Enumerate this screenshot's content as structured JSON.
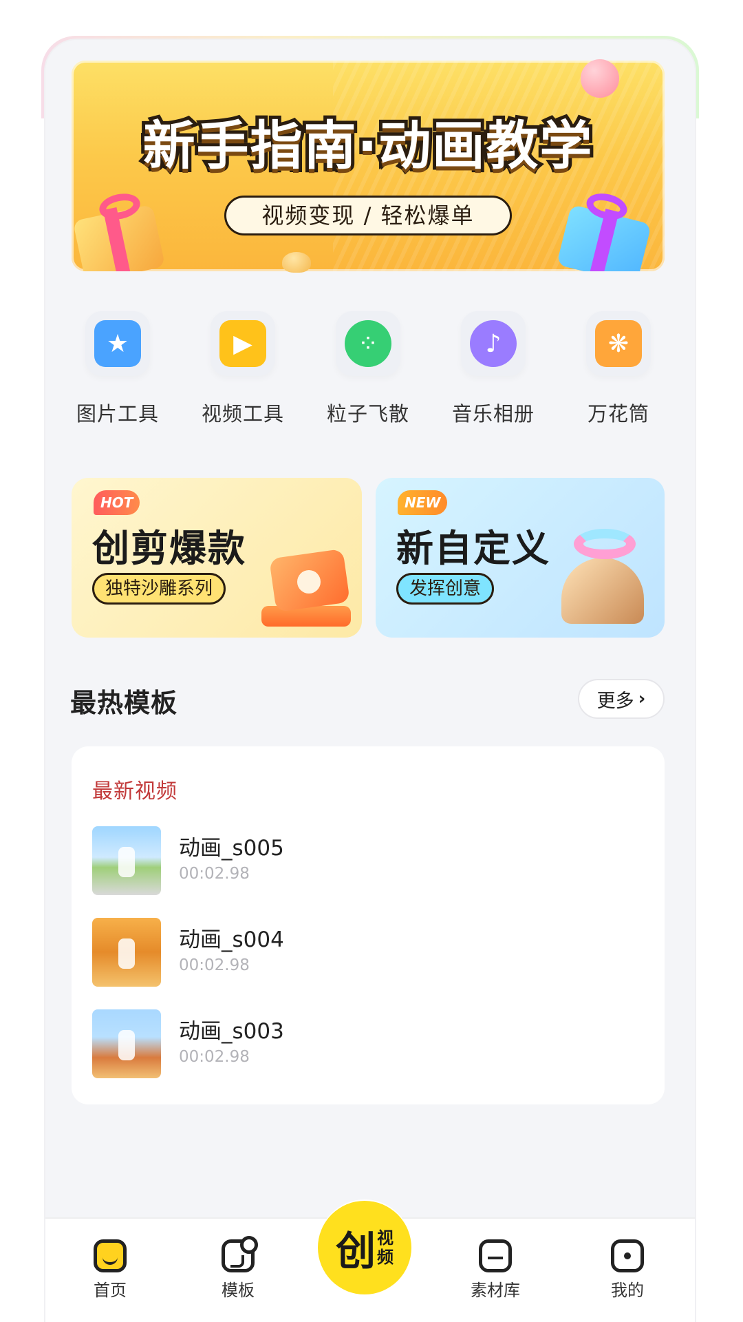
{
  "banner": {
    "title": "新手指南·动画教学",
    "subtitle": "视频变现 / 轻松爆单"
  },
  "tools": [
    {
      "label": "图片工具",
      "icon": "star-image-icon",
      "color": "#4aa3ff"
    },
    {
      "label": "视频工具",
      "icon": "video-camera-icon",
      "color": "#ffc21a"
    },
    {
      "label": "粒子飞散",
      "icon": "particles-icon",
      "color": "#36cf74"
    },
    {
      "label": "音乐相册",
      "icon": "music-heart-icon",
      "color": "#9a7cff"
    },
    {
      "label": "万花筒",
      "icon": "kaleidoscope-icon",
      "color": "#ffa63a"
    }
  ],
  "promo": {
    "hot": {
      "tag": "HOT",
      "title": "创剪爆款",
      "chip": "独特沙雕系列"
    },
    "new": {
      "tag": "NEW",
      "title": "新自定义",
      "chip": "发挥创意"
    }
  },
  "section": {
    "title": "最热模板",
    "more": "更多"
  },
  "videos": {
    "heading": "最新视频",
    "items": [
      {
        "name": "动画_s005",
        "duration": "00:02.98"
      },
      {
        "name": "动画_s004",
        "duration": "00:02.98"
      },
      {
        "name": "动画_s003",
        "duration": "00:02.98"
      }
    ]
  },
  "nav": {
    "home": "首页",
    "template": "模板",
    "create_big": "创",
    "create_small_1": "视",
    "create_small_2": "频",
    "library": "素材库",
    "me": "我的"
  }
}
